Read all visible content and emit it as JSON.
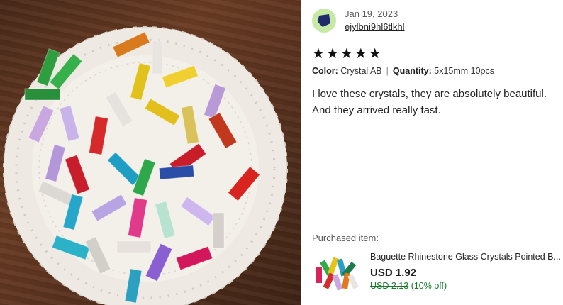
{
  "review": {
    "date": "Jan 19, 2023",
    "username": "ejylbni9hl6tlkhl",
    "rating": 5,
    "stars": [
      "★",
      "★",
      "★",
      "★",
      "★"
    ],
    "color_label": "Color:",
    "color_value": "Crystal AB",
    "quantity_label": "Quantity:",
    "quantity_value": "5x15mm 10pcs",
    "text": "I love these crystals, they are absolutely beautiful. And they arrived really fast."
  },
  "purchased": {
    "label": "Purchased item:",
    "title": "Baguette Rhinestone Glass Crystals Pointed B...",
    "price": "USD 1.92",
    "original_price": "USD 2.13",
    "discount": "(10% off)"
  },
  "colors": {
    "avatar_bg": "#c7e9a6",
    "avatar_icon": "#1f2a6b",
    "discount_green": "#1a7a2e"
  },
  "icons": {
    "avatar": "pentagon-icon",
    "rating": "star-icon"
  }
}
